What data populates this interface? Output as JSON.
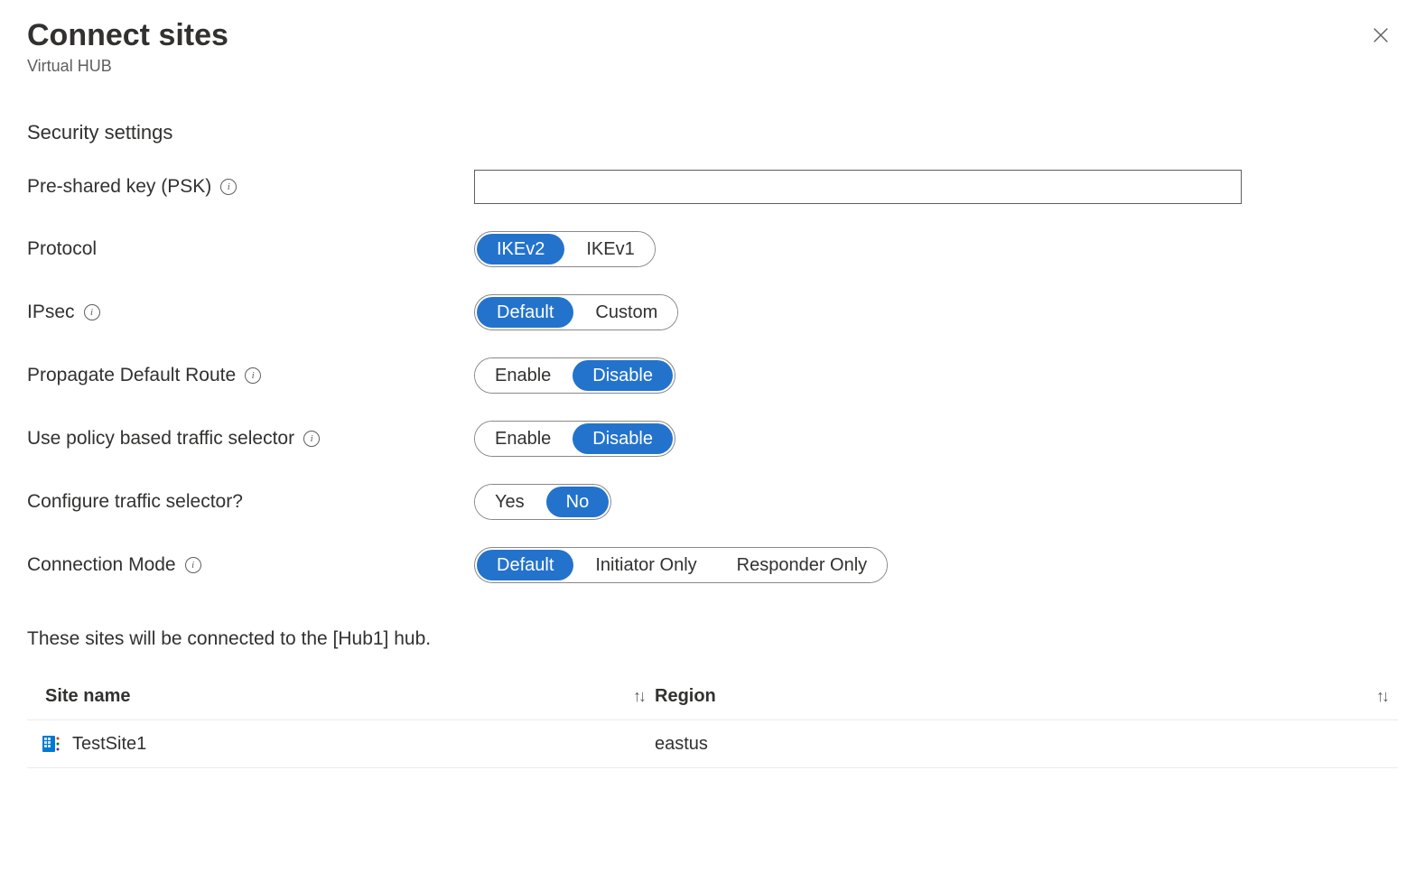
{
  "header": {
    "title": "Connect sites",
    "subtitle": "Virtual HUB"
  },
  "section_heading": "Security settings",
  "form": {
    "psk_label": "Pre-shared key (PSK)",
    "psk_value": "",
    "protocol_label": "Protocol",
    "protocol_options": [
      "IKEv2",
      "IKEv1"
    ],
    "protocol_selected": "IKEv2",
    "ipsec_label": "IPsec",
    "ipsec_options": [
      "Default",
      "Custom"
    ],
    "ipsec_selected": "Default",
    "propagate_label": "Propagate Default Route",
    "propagate_options": [
      "Enable",
      "Disable"
    ],
    "propagate_selected": "Disable",
    "policy_selector_label": "Use policy based traffic selector",
    "policy_selector_options": [
      "Enable",
      "Disable"
    ],
    "policy_selector_selected": "Disable",
    "configure_selector_label": "Configure traffic selector?",
    "configure_selector_options": [
      "Yes",
      "No"
    ],
    "configure_selector_selected": "No",
    "connection_mode_label": "Connection Mode",
    "connection_mode_options": [
      "Default",
      "Initiator Only",
      "Responder Only"
    ],
    "connection_mode_selected": "Default"
  },
  "description": "These sites will be connected to the [Hub1] hub.",
  "table": {
    "columns": {
      "name": "Site name",
      "region": "Region"
    },
    "rows": [
      {
        "name": "TestSite1",
        "region": "eastus"
      }
    ]
  }
}
